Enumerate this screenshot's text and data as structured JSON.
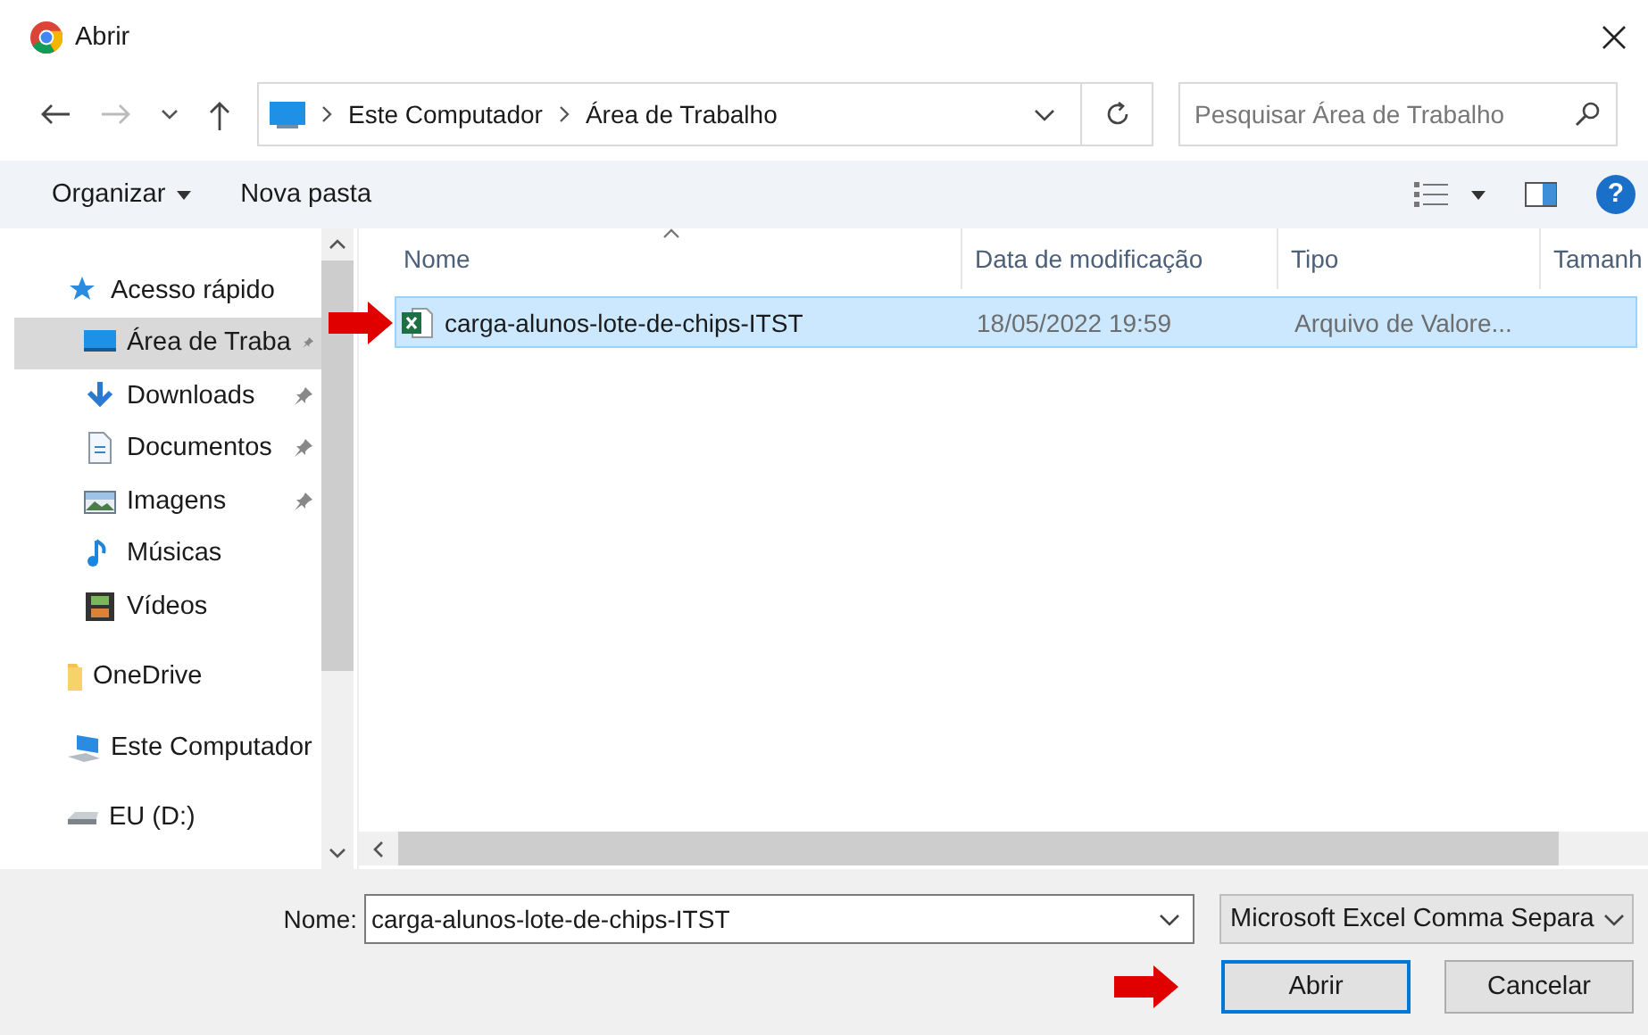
{
  "window": {
    "title": "Abrir"
  },
  "address": {
    "path": [
      "Este Computador",
      "Área de Trabalho"
    ],
    "search_placeholder": "Pesquisar Área de Trabalho"
  },
  "toolbar": {
    "organize": "Organizar",
    "new_folder": "Nova pasta",
    "help": "?"
  },
  "sidebar": {
    "items": [
      {
        "label": "Acesso rápido",
        "kind": "star",
        "selected": false,
        "children": [
          {
            "label": "Área de Traba",
            "kind": "desktop",
            "pinned": true,
            "selected": true
          },
          {
            "label": "Downloads",
            "kind": "download",
            "pinned": true,
            "selected": false
          },
          {
            "label": "Documentos",
            "kind": "document",
            "pinned": true,
            "selected": false
          },
          {
            "label": "Imagens",
            "kind": "image",
            "pinned": true,
            "selected": false
          },
          {
            "label": "Músicas",
            "kind": "music",
            "pinned": false,
            "selected": false
          },
          {
            "label": "Vídeos",
            "kind": "video",
            "pinned": false,
            "selected": false
          }
        ]
      },
      {
        "label": "OneDrive",
        "kind": "folder",
        "selected": false
      },
      {
        "label": "Este Computador",
        "kind": "computer",
        "selected": false
      },
      {
        "label": "EU (D:)",
        "kind": "drive",
        "selected": false
      }
    ]
  },
  "table": {
    "columns": [
      "Nome",
      "Data de modificação",
      "Tipo",
      "Tamanh"
    ],
    "rows": [
      {
        "cells": [
          "carga-alunos-lote-de-chips-ITST",
          "18/05/2022 19:59",
          "Arquivo de Valore..."
        ],
        "selected": true
      }
    ]
  },
  "footer": {
    "name_label": "Nome:",
    "name_value": "carga-alunos-lote-de-chips-ITST",
    "file_type": "Microsoft Excel Comma Separa",
    "buttons": [
      {
        "label": "Abrir",
        "default": true
      },
      {
        "label": "Cancelar",
        "default": false
      }
    ]
  }
}
